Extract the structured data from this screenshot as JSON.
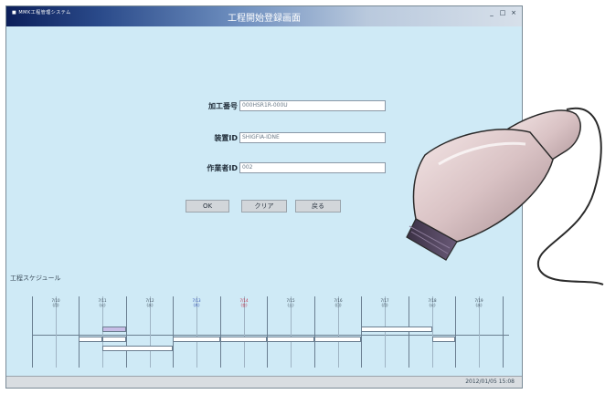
{
  "window": {
    "app_caption": "■ MMK工程管理システム",
    "title": "工程開始登録画面",
    "controls": [
      "_",
      "□",
      "×"
    ]
  },
  "form": {
    "fields": [
      {
        "label": "加工番号",
        "value": "000HSR1R-000U"
      },
      {
        "label": "装置ID",
        "value": "SHIGFIA-IDNE"
      },
      {
        "label": "作業者ID",
        "value": "002"
      }
    ],
    "buttons": [
      "OK",
      "クリア",
      "戻る"
    ]
  },
  "schedule": {
    "title": "工程スケジュール",
    "days": [
      {
        "date": "7/10",
        "dow": "(月)"
      },
      {
        "date": "7/11",
        "dow": "(火)"
      },
      {
        "date": "7/12",
        "dow": "(水)"
      },
      {
        "date": "7/13",
        "dow": "(木)"
      },
      {
        "date": "7/14",
        "dow": "(金)"
      },
      {
        "date": "7/15",
        "dow": "(土)"
      },
      {
        "date": "7/16",
        "dow": "(日)"
      },
      {
        "date": "7/17",
        "dow": "(月)"
      },
      {
        "date": "7/18",
        "dow": "(火)"
      },
      {
        "date": "7/19",
        "dow": "(水)"
      }
    ]
  },
  "status": {
    "datetime": "2012/01/05 15:08"
  },
  "colors": {
    "background": "#cfeaf6",
    "title_gradient_start": "#0c1f5a",
    "bar_purple": "#c7bde6"
  },
  "illustration": {
    "icon": "barcode-scanner-icon"
  }
}
